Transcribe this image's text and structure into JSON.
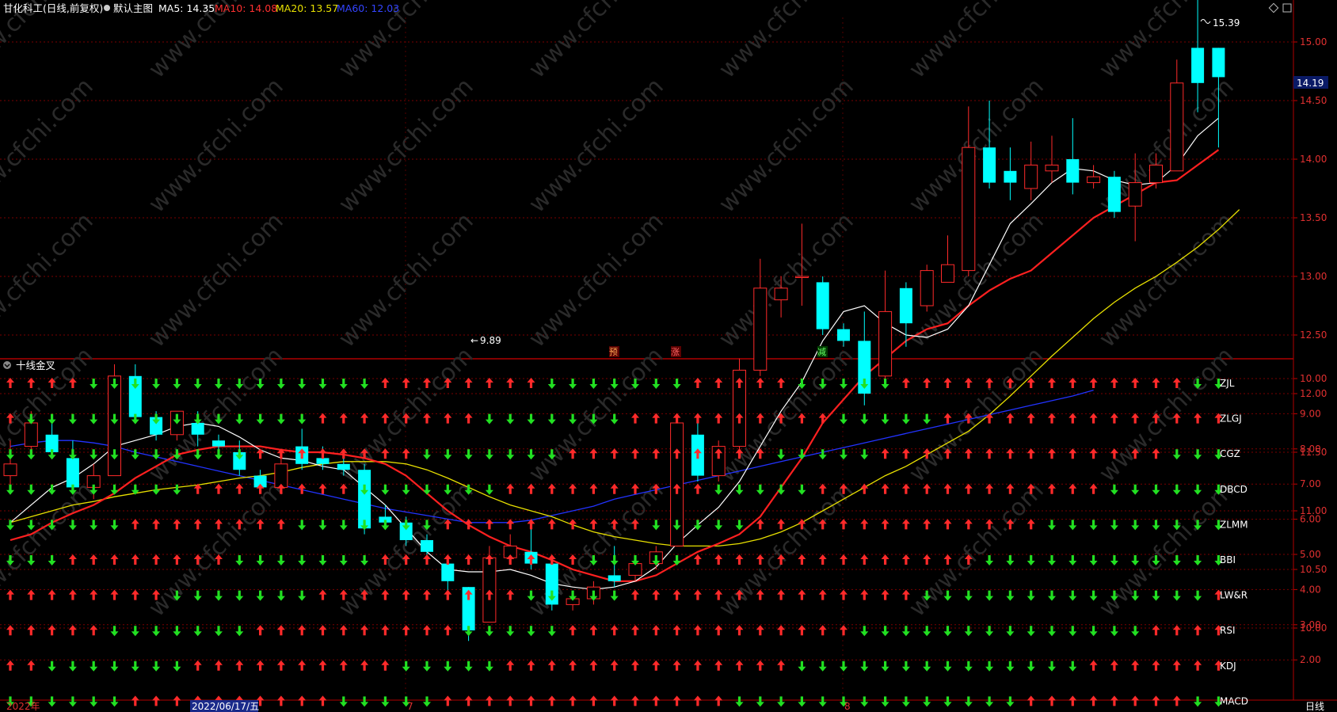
{
  "header": {
    "stock": "甘化科工(日线,前复权)",
    "main_chart": "默认主图",
    "ma5": "MA5: 14.35",
    "ma10": "MA10: 14.08",
    "ma20": "MA20: 13.57",
    "ma60": "MA60: 12.03"
  },
  "sub_panel": {
    "title": "十线金叉"
  },
  "footer": {
    "year": "2022年",
    "cursor_date": "2022/06/17/五",
    "month7": "7",
    "month8": "8",
    "period": "日线"
  },
  "current_price": "14.19",
  "high_label": "15.39",
  "low_label": "9.89",
  "markers": [
    "预",
    "涨",
    "减"
  ],
  "colors": {
    "up": "#ff2a2a",
    "down": "#00ffff",
    "ma5": "#ffffff",
    "ma10": "#ff2020",
    "ma20": "#e8e000",
    "ma60": "#2233ff",
    "grid": "#7a0000",
    "arrow_up": "#ff2a2a",
    "arrow_down": "#22e022"
  },
  "chart_data": {
    "type": "candlestick",
    "ylim": [
      9.7,
      15.4
    ],
    "price_ticks": [
      "15.00",
      "14.50",
      "14.00",
      "13.50",
      "13.00",
      "12.50",
      "12.00",
      "11.50",
      "11.00",
      "10.50",
      "10.00"
    ],
    "candles": [
      {
        "o": 11.3,
        "c": 11.4,
        "h": 11.6,
        "l": 11.2
      },
      {
        "o": 11.55,
        "c": 11.75,
        "h": 11.85,
        "l": 11.5
      },
      {
        "o": 11.65,
        "c": 11.5,
        "h": 11.8,
        "l": 11.45
      },
      {
        "o": 11.45,
        "c": 11.2,
        "h": 11.6,
        "l": 11.15
      },
      {
        "o": 11.2,
        "c": 11.3,
        "h": 11.4,
        "l": 11.1
      },
      {
        "o": 11.3,
        "c": 12.15,
        "h": 12.25,
        "l": 11.3
      },
      {
        "o": 12.15,
        "c": 11.8,
        "h": 12.25,
        "l": 11.75
      },
      {
        "o": 11.8,
        "c": 11.65,
        "h": 11.85,
        "l": 11.6
      },
      {
        "o": 11.65,
        "c": 11.85,
        "h": 11.85,
        "l": 11.6
      },
      {
        "o": 11.75,
        "c": 11.65,
        "h": 11.85,
        "l": 11.55
      },
      {
        "o": 11.6,
        "c": 11.55,
        "h": 11.65,
        "l": 11.5
      },
      {
        "o": 11.5,
        "c": 11.35,
        "h": 11.6,
        "l": 11.3
      },
      {
        "o": 11.3,
        "c": 11.2,
        "h": 11.35,
        "l": 11.15
      },
      {
        "o": 11.2,
        "c": 11.4,
        "h": 11.45,
        "l": 11.15
      },
      {
        "o": 11.55,
        "c": 11.4,
        "h": 11.7,
        "l": 11.35
      },
      {
        "o": 11.45,
        "c": 11.4,
        "h": 11.55,
        "l": 11.35
      },
      {
        "o": 11.4,
        "c": 11.35,
        "h": 11.5,
        "l": 11.3
      },
      {
        "o": 11.35,
        "c": 10.85,
        "h": 11.4,
        "l": 10.8
      },
      {
        "o": 10.95,
        "c": 10.9,
        "h": 11.05,
        "l": 10.85
      },
      {
        "o": 10.9,
        "c": 10.75,
        "h": 10.95,
        "l": 10.7
      },
      {
        "o": 10.75,
        "c": 10.65,
        "h": 10.8,
        "l": 10.55
      },
      {
        "o": 10.55,
        "c": 10.4,
        "h": 10.6,
        "l": 10.3
      },
      {
        "o": 10.35,
        "c": 9.98,
        "h": 10.35,
        "l": 9.89
      },
      {
        "o": 10.05,
        "c": 10.6,
        "h": 10.7,
        "l": 10.05
      },
      {
        "o": 10.6,
        "c": 10.7,
        "h": 10.8,
        "l": 10.55
      },
      {
        "o": 10.65,
        "c": 10.55,
        "h": 10.9,
        "l": 10.5
      },
      {
        "o": 10.55,
        "c": 10.2,
        "h": 10.6,
        "l": 10.15
      },
      {
        "o": 10.2,
        "c": 10.25,
        "h": 10.3,
        "l": 10.15
      },
      {
        "o": 10.25,
        "c": 10.35,
        "h": 10.4,
        "l": 10.2
      },
      {
        "o": 10.45,
        "c": 10.4,
        "h": 10.7,
        "l": 10.35
      },
      {
        "o": 10.45,
        "c": 10.55,
        "h": 10.6,
        "l": 10.4
      },
      {
        "o": 10.55,
        "c": 10.65,
        "h": 10.7,
        "l": 10.5
      },
      {
        "o": 10.7,
        "c": 11.75,
        "h": 11.75,
        "l": 10.7
      },
      {
        "o": 11.65,
        "c": 11.3,
        "h": 11.75,
        "l": 11.25
      },
      {
        "o": 11.3,
        "c": 11.55,
        "h": 11.6,
        "l": 11.25
      },
      {
        "o": 11.55,
        "c": 12.2,
        "h": 12.3,
        "l": 11.5
      },
      {
        "o": 12.2,
        "c": 12.9,
        "h": 13.15,
        "l": 12.15
      },
      {
        "o": 12.8,
        "c": 12.9,
        "h": 13.0,
        "l": 12.65
      },
      {
        "o": 13.0,
        "c": 13.0,
        "h": 13.45,
        "l": 12.75
      },
      {
        "o": 12.95,
        "c": 12.55,
        "h": 13.0,
        "l": 12.5
      },
      {
        "o": 12.55,
        "c": 12.45,
        "h": 12.6,
        "l": 12.4
      },
      {
        "o": 12.45,
        "c": 12.0,
        "h": 12.7,
        "l": 11.9
      },
      {
        "o": 12.15,
        "c": 12.7,
        "h": 13.05,
        "l": 12.1
      },
      {
        "o": 12.9,
        "c": 12.6,
        "h": 12.95,
        "l": 12.4
      },
      {
        "o": 12.75,
        "c": 13.05,
        "h": 13.1,
        "l": 12.7
      },
      {
        "o": 12.95,
        "c": 13.1,
        "h": 13.35,
        "l": 12.95
      },
      {
        "o": 13.05,
        "c": 14.1,
        "h": 14.45,
        "l": 13.0
      },
      {
        "o": 14.1,
        "c": 13.8,
        "h": 14.5,
        "l": 13.75
      },
      {
        "o": 13.9,
        "c": 13.8,
        "h": 14.1,
        "l": 13.65
      },
      {
        "o": 13.75,
        "c": 13.95,
        "h": 14.15,
        "l": 13.65
      },
      {
        "o": 13.9,
        "c": 13.95,
        "h": 14.2,
        "l": 13.8
      },
      {
        "o": 14.0,
        "c": 13.8,
        "h": 14.35,
        "l": 13.7
      },
      {
        "o": 13.8,
        "c": 13.85,
        "h": 13.95,
        "l": 13.75
      },
      {
        "o": 13.85,
        "c": 13.55,
        "h": 13.9,
        "l": 13.5
      },
      {
        "o": 13.6,
        "c": 13.8,
        "h": 14.05,
        "l": 13.3
      },
      {
        "o": 13.8,
        "c": 13.95,
        "h": 14.05,
        "l": 13.75
      },
      {
        "o": 13.9,
        "c": 14.65,
        "h": 14.85,
        "l": 13.9
      },
      {
        "o": 14.95,
        "c": 14.65,
        "h": 15.39,
        "l": 14.4
      },
      {
        "o": 14.95,
        "c": 14.7,
        "h": 14.95,
        "l": 14.1
      }
    ],
    "ma5": [
      10.9,
      11.05,
      11.2,
      11.28,
      11.4,
      11.55,
      11.6,
      11.65,
      11.72,
      11.75,
      11.72,
      11.63,
      11.52,
      11.45,
      11.43,
      11.38,
      11.35,
      11.2,
      11.05,
      10.85,
      10.65,
      10.5,
      10.48,
      10.48,
      10.5,
      10.45,
      10.38,
      10.35,
      10.33,
      10.35,
      10.4,
      10.52,
      10.72,
      10.88,
      11.03,
      11.25,
      11.55,
      11.85,
      12.1,
      12.45,
      12.7,
      12.75,
      12.6,
      12.5,
      12.48,
      12.55,
      12.75,
      13.1,
      13.45,
      13.62,
      13.8,
      13.92,
      13.9,
      13.82,
      13.78,
      13.8,
      13.95,
      14.2,
      14.35
    ],
    "ma10": [
      10.75,
      10.8,
      10.9,
      10.98,
      11.05,
      11.15,
      11.28,
      11.38,
      11.48,
      11.52,
      11.55,
      11.55,
      11.55,
      11.52,
      11.5,
      11.5,
      11.48,
      11.45,
      11.4,
      11.3,
      11.15,
      11.0,
      10.88,
      10.78,
      10.7,
      10.65,
      10.58,
      10.5,
      10.45,
      10.4,
      10.4,
      10.45,
      10.55,
      10.65,
      10.72,
      10.8,
      10.95,
      11.2,
      11.45,
      11.75,
      11.95,
      12.15,
      12.3,
      12.45,
      12.55,
      12.6,
      12.75,
      12.88,
      12.98,
      13.05,
      13.2,
      13.35,
      13.5,
      13.6,
      13.7,
      13.8,
      13.82,
      13.95,
      14.08
    ],
    "ma20": [
      10.9,
      10.95,
      11.0,
      11.05,
      11.08,
      11.12,
      11.15,
      11.18,
      11.2,
      11.22,
      11.25,
      11.28,
      11.3,
      11.33,
      11.37,
      11.4,
      11.42,
      11.42,
      11.42,
      11.4,
      11.35,
      11.28,
      11.2,
      11.12,
      11.05,
      11.0,
      10.95,
      10.88,
      10.82,
      10.78,
      10.75,
      10.72,
      10.7,
      10.7,
      10.7,
      10.72,
      10.76,
      10.82,
      10.9,
      11.0,
      11.1,
      11.2,
      11.3,
      11.38,
      11.48,
      11.58,
      11.68,
      11.82,
      11.98,
      12.15,
      12.32,
      12.48,
      12.64,
      12.78,
      12.9,
      13.0,
      13.12,
      13.25,
      13.4,
      13.57
    ],
    "ma60": [
      11.55,
      11.58,
      11.6,
      11.6,
      11.58,
      11.55,
      11.5,
      11.46,
      11.42,
      11.38,
      11.34,
      11.3,
      11.26,
      11.22,
      11.18,
      11.14,
      11.1,
      11.06,
      11.02,
      10.99,
      10.96,
      10.93,
      10.9,
      10.9,
      10.9,
      10.92,
      10.96,
      11.0,
      11.04,
      11.1,
      11.14,
      11.18,
      11.22,
      11.26,
      11.3,
      11.34,
      11.38,
      11.42,
      11.46,
      11.5,
      11.54,
      11.58,
      11.62,
      11.66,
      11.7,
      11.74,
      11.78,
      11.82,
      11.86,
      11.9,
      11.94,
      11.98,
      12.03
    ],
    "indicator_ticks": [
      "10.00",
      "9.00",
      "8.00",
      "7.00",
      "6.00",
      "5.00",
      "4.00",
      "3.00",
      "2.00"
    ],
    "indicator_rows": [
      "ZJL",
      "ZLGJ",
      "CGZ",
      "DBCD",
      "ZLMM",
      "BBI",
      "LW&R",
      "RSI",
      "KDJ",
      "MACD"
    ],
    "signal_pattern": "UUUUDDDDDDDDDDDDDDUUUUUUUUDDDDDDDUUUUUUUUUUDDDDDUUUUUUUUUU"
  }
}
